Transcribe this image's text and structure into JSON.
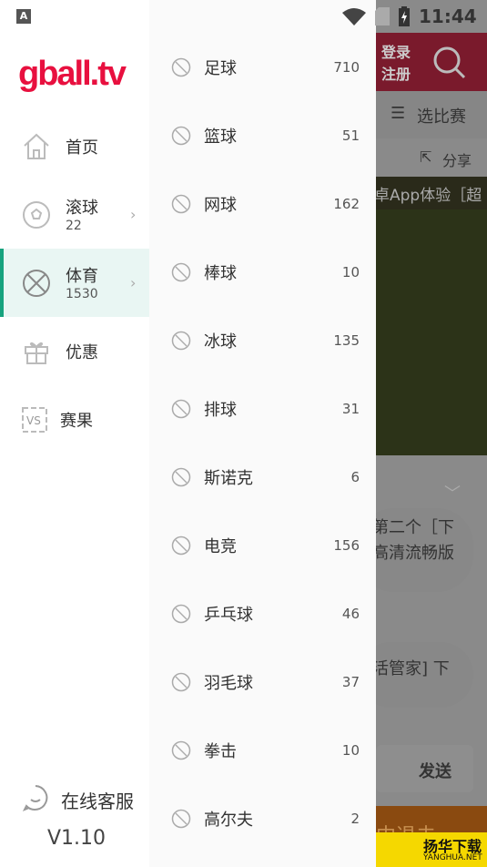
{
  "status": {
    "time": "11:44",
    "notif_icon": "A"
  },
  "logo": "gball.tv",
  "nav": [
    {
      "label": "首页",
      "icon": "home-icon"
    },
    {
      "label": "滚球",
      "sub": "22",
      "icon": "soccer-ball-icon"
    },
    {
      "label": "体育",
      "sub": "1530",
      "icon": "basketball-icon",
      "active": true
    },
    {
      "label": "优惠",
      "icon": "gift-icon"
    },
    {
      "label": "赛果",
      "icon": "versus-icon"
    }
  ],
  "support": "在线客服",
  "version": "V1.10",
  "sports": [
    {
      "label": "足球",
      "count": "710"
    },
    {
      "label": "篮球",
      "count": "51"
    },
    {
      "label": "网球",
      "count": "162"
    },
    {
      "label": "棒球",
      "count": "10"
    },
    {
      "label": "冰球",
      "count": "135"
    },
    {
      "label": "排球",
      "count": "31"
    },
    {
      "label": "斯诺克",
      "count": "6"
    },
    {
      "label": "电竞",
      "count": "156"
    },
    {
      "label": "乒乓球",
      "count": "46"
    },
    {
      "label": "羽毛球",
      "count": "37"
    },
    {
      "label": "拳击",
      "count": "10"
    },
    {
      "label": "高尔夫",
      "count": "2"
    }
  ],
  "bg": {
    "login": "登录",
    "register": "注册",
    "select": "选比赛",
    "share": "分享",
    "marquee": "卓App体验［超",
    "msg1a": "第二个［下",
    "msg1b": "高清流畅版",
    "msg2": "活管家] 下",
    "send": "发送",
    "banner": "中退去",
    "watermark": "扬华下载",
    "watermark_en": "YANGHUA.NET",
    "brand_color": "#e8103f",
    "accent": "#17a37e"
  }
}
